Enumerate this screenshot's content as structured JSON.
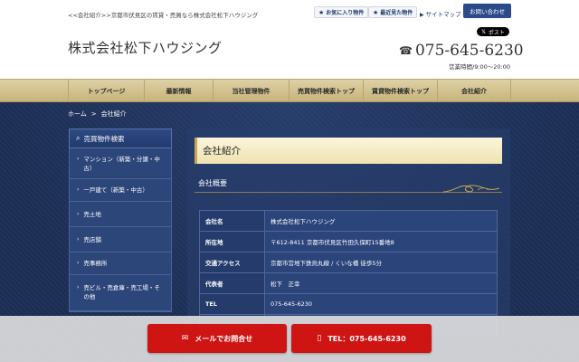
{
  "header": {
    "tagline": "<<会社紹介>>京都市伏見区の賃貸・売買なら株式会社松下ハウジング",
    "favorites": {
      "icon": "star-icon",
      "label": "お気に入り物件"
    },
    "recent": {
      "icon": "star-icon",
      "label": "最近見た物件"
    },
    "sitemap": {
      "icon": "arrow-icon",
      "label": "サイトマップ"
    },
    "contact": "お問い合わせ",
    "x_post": {
      "icon": "x-logo-icon",
      "label": "ポスト"
    },
    "company_name": "株式会社松下ハウジング",
    "phone": {
      "icon": "phone-icon",
      "number": "075-645-6230"
    },
    "hours": "営業時間/9:00～20:00"
  },
  "nav": {
    "items": [
      "トップページ",
      "最新情報",
      "当社管理物件",
      "売買物件検索トップ",
      "賃貸物件検索トップ",
      "会社紹介"
    ]
  },
  "breadcrumb": {
    "home": "ホーム",
    "separator": ">",
    "current": "会社紹介"
  },
  "sidebar": {
    "title": "売買物件検索",
    "items": [
      "マンション（新築・分譲・中古）",
      "一戸建て（新築・中古）",
      "売土地",
      "売店舗",
      "売事務所",
      "売ビル・売倉庫・売工場・その他"
    ]
  },
  "content": {
    "title": "会社紹介",
    "section": "会社概要",
    "rows": [
      {
        "key": "会社名",
        "value": "株式会社松下ハウジング"
      },
      {
        "key": "所在地",
        "value": "〒612-8411 京都市伏見区竹田久保町15番地8"
      },
      {
        "key": "交通アクセス",
        "value": "京都市営地下鉄烏丸線 / くいな橋 徒歩5分"
      },
      {
        "key": "代表者",
        "value": "松下　正幸"
      },
      {
        "key": "TEL",
        "value": "075-645-6230"
      },
      {
        "key": "",
        "value": ""
      }
    ]
  },
  "cta": {
    "mail": {
      "icon": "mail-icon",
      "label": "メールでお問合せ"
    },
    "tel": {
      "icon": "mobile-phone-icon",
      "label": "TEL：075-645-6230"
    }
  },
  "colors": {
    "navy": "#1c2e55",
    "gold": "#c9a64d",
    "cta_red": "#cf1414",
    "header_button": "#2b4a87"
  }
}
